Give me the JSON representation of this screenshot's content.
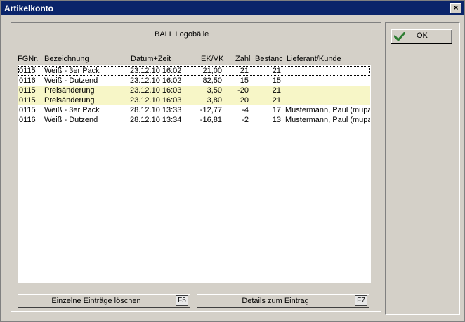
{
  "window": {
    "title": "Artikelkonto",
    "close_glyph": "×"
  },
  "article": {
    "title": "BALL  Logobälle"
  },
  "columns": [
    {
      "key": "fgnr",
      "label": "FGNr."
    },
    {
      "key": "bezeichnung",
      "label": "Bezeichnung"
    },
    {
      "key": "datum",
      "label": "Datum+Zeit"
    },
    {
      "key": "ekvk",
      "label": "EK/VK"
    },
    {
      "key": "zahl",
      "label": "Zahl"
    },
    {
      "key": "bestand",
      "label": "Bestanc"
    },
    {
      "key": "lieferant",
      "label": "Lieferant/Kunde"
    }
  ],
  "rows": [
    {
      "fgnr": "0115",
      "bezeichnung": "Weiß - 3er Pack",
      "datum": "23.12.10 16:02",
      "ekvk": "21,00",
      "zahl": "21",
      "bestand": "21",
      "lieferant": "",
      "highlight": false,
      "focused": true
    },
    {
      "fgnr": "0116",
      "bezeichnung": "Weiß - Dutzend",
      "datum": "23.12.10 16:02",
      "ekvk": "82,50",
      "zahl": "15",
      "bestand": "15",
      "lieferant": "",
      "highlight": false,
      "focused": false
    },
    {
      "fgnr": "0115",
      "bezeichnung": "Preisänderung",
      "datum": "23.12.10 16:03",
      "ekvk": "3,50",
      "zahl": "-20",
      "bestand": "21",
      "lieferant": "",
      "highlight": true,
      "focused": false
    },
    {
      "fgnr": "0115",
      "bezeichnung": "Preisänderung",
      "datum": "23.12.10 16:03",
      "ekvk": "3,80",
      "zahl": "20",
      "bestand": "21",
      "lieferant": "",
      "highlight": true,
      "focused": false
    },
    {
      "fgnr": "0115",
      "bezeichnung": "Weiß - 3er Pack",
      "datum": "28.12.10 13:33",
      "ekvk": "-12,77",
      "zahl": "-4",
      "bestand": "17",
      "lieferant": "Mustermann, Paul (mupa)",
      "highlight": false,
      "focused": false
    },
    {
      "fgnr": "0116",
      "bezeichnung": "Weiß - Dutzend",
      "datum": "28.12.10 13:34",
      "ekvk": "-16,81",
      "zahl": "-2",
      "bestand": "13",
      "lieferant": "Mustermann, Paul (mupa)",
      "highlight": false,
      "focused": false
    }
  ],
  "buttons": {
    "delete": {
      "label": "Einzelne Einträge löschen",
      "key": "F5"
    },
    "details": {
      "label": "Details zum Eintrag",
      "key": "F7"
    },
    "ok": {
      "label": "OK",
      "icon": "check-icon"
    }
  },
  "colors": {
    "titlebar": "#0a246a",
    "row_highlight": "#f7f6c7",
    "ok_check": "#2e7d32"
  }
}
